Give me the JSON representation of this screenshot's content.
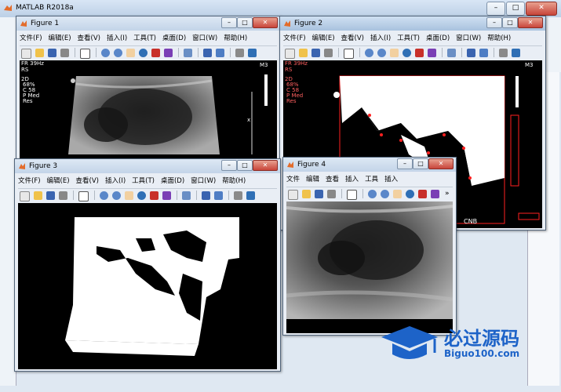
{
  "app": {
    "title": "MATLAB R2018a"
  },
  "menu_items": [
    "文件(F)",
    "编辑(E)",
    "查看(V)",
    "插入(I)",
    "工具(T)",
    "桌面(D)",
    "窗口(W)",
    "帮助(H)"
  ],
  "menu_short": [
    "文件",
    "编辑",
    "查看",
    "插入",
    "工具",
    "插入"
  ],
  "menu_more": "»",
  "figures": [
    {
      "title": "Figure 1"
    },
    {
      "title": "Figure 2"
    },
    {
      "title": "Figure 3"
    },
    {
      "title": "Figure 4"
    }
  ],
  "ultrasound_overlay": {
    "line1": "FR 39Hz",
    "line2": "RS",
    "line3": "2D",
    "line4": "68%",
    "line5": "C 58",
    "line6": "P Med",
    "line7": "Res",
    "m3": "M3",
    "cnb": "CNB"
  },
  "window_controls": {
    "min": "–",
    "max": "□",
    "close": "✕"
  },
  "watermark": {
    "text": "必过源码",
    "sub": "Biguo100.com"
  },
  "colors": {
    "title_bar": "#c3d4e8",
    "close": "#c8453a",
    "red_outline": "#ff2020",
    "watermark_blue": "#1d63c8"
  }
}
